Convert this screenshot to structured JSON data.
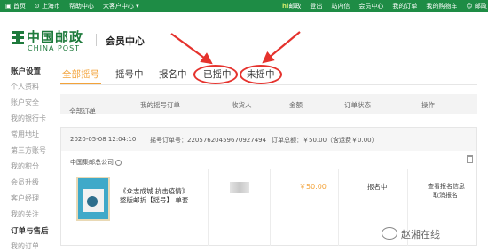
{
  "topbar": {
    "home": "首页",
    "city": "上海市",
    "help": "帮助中心",
    "vip": "大客户中心",
    "brand_hl": "hi",
    "brand_rest": "邮政",
    "login": "登出",
    "station": "站内信",
    "member_center": "会员中心",
    "my_orders": "我的订单",
    "my_cart": "我的购物车",
    "user": "邮政",
    "accent": "#1e8c45"
  },
  "header": {
    "logo_cn": "中国邮政",
    "logo_en": "CHINA POST",
    "title": "会员中心"
  },
  "sidebar": {
    "section1": "账户设置",
    "items1": [
      "个人资料",
      "账户安全",
      "我的银行卡",
      "常用地址",
      "第三方账号",
      "我的积分",
      "会员升级",
      "客户经理",
      "我的关注"
    ],
    "section2": "订单与售后",
    "items2": [
      "我的订单"
    ]
  },
  "tabs": [
    "全部摇号",
    "摇号中",
    "报名中",
    "已摇中",
    "未摇中"
  ],
  "table_headers": {
    "all_orders": "全部订单",
    "my_order": "我的摇号订单",
    "recipient": "收货人",
    "amount": "金额",
    "order_status": "订单状态",
    "operation": "操作"
  },
  "order": {
    "datetime": "2020-05-08 12:04:10",
    "order_no": "摇号订单号：22057620459670927494",
    "total": "订单总额：￥50.00（含运费￥0.00）",
    "store": "中国集邮总公司",
    "product_name": "《众志成城 抗击疫情》整版邮折【摇号】 单套",
    "price": "￥50.00",
    "status": "报名中",
    "op1": "查看报名信息",
    "op2": "取消报名"
  },
  "watermark": "赵湘在线",
  "colors": {
    "active_tab": "#f3a33a",
    "annotation": "#e5322d",
    "green": "#1e8c45"
  }
}
